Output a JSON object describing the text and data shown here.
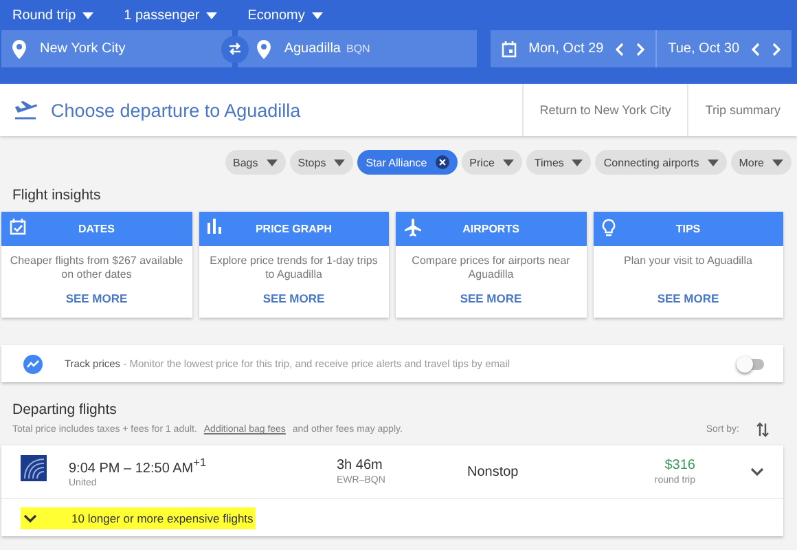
{
  "trip_options": [
    {
      "label": "Round trip"
    },
    {
      "label": "1 passenger"
    },
    {
      "label": "Economy"
    }
  ],
  "origin": {
    "value": "New York City"
  },
  "destination": {
    "value": "Aguadilla",
    "code": "BQN"
  },
  "depart_date": {
    "value": "Mon, Oct 29"
  },
  "return_date": {
    "value": "Tue, Oct 30"
  },
  "header": {
    "title": "Choose departure to Aguadilla",
    "steps": [
      {
        "label": "Return to New York City"
      },
      {
        "label": "Trip summary"
      }
    ]
  },
  "filters": [
    {
      "label": "Bags",
      "selected": false
    },
    {
      "label": "Stops",
      "selected": false
    },
    {
      "label": "Star Alliance",
      "selected": true
    },
    {
      "label": "Price",
      "selected": false
    },
    {
      "label": "Times",
      "selected": false
    },
    {
      "label": "Connecting airports",
      "selected": false
    },
    {
      "label": "More",
      "selected": false
    }
  ],
  "insights": {
    "title": "Flight insights",
    "cards": [
      {
        "kind": "calendar",
        "title": "DATES",
        "text": "Cheaper flights from $267 available on other dates",
        "link": "SEE MORE"
      },
      {
        "kind": "graph",
        "title": "PRICE GRAPH",
        "text": "Explore price trends for 1-day trips to Aguadilla",
        "link": "SEE MORE"
      },
      {
        "kind": "plane",
        "title": "AIRPORTS",
        "text": "Compare prices for airports near Aguadilla",
        "link": "SEE MORE"
      },
      {
        "kind": "bulb",
        "title": "TIPS",
        "text": "Plan your visit to Aguadilla",
        "link": "SEE MORE"
      }
    ]
  },
  "track_prices": {
    "label": "Track prices",
    "text": "- Monitor the lowest price for this trip, and receive price alerts and travel tips by email",
    "on": false
  },
  "departing": {
    "title": "Departing flights",
    "note": "Total price includes taxes + fees for 1 adult.",
    "note_link": "Additional bag fees",
    "note_end": "and other fees may apply.",
    "sort_label": "Sort by:",
    "flights": [
      {
        "times": "9:04 PM – 12:50 AM$^{+1}$",
        "airline": "United",
        "duration": "3h 46m",
        "route": "EWR–BQN",
        "stops": "Nonstop",
        "price": "$316",
        "price_note": "round trip"
      }
    ],
    "more_flights": {
      "label": "10 longer or more expensive flights",
      "highlighted": true
    }
  }
}
